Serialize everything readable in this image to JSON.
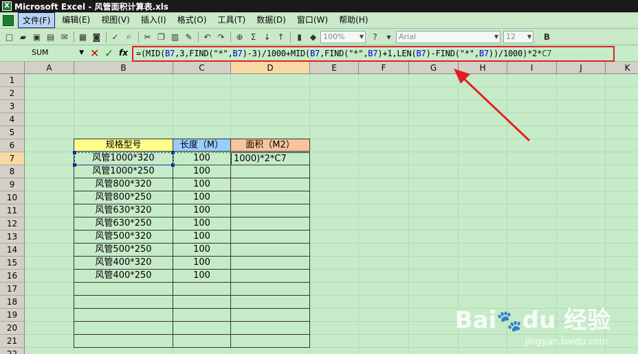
{
  "window": {
    "title": "Microsoft Excel - 风管面积计算表.xls"
  },
  "menu": [
    {
      "label": "文件(F)",
      "active": true
    },
    {
      "label": "编辑(E)"
    },
    {
      "label": "视图(V)"
    },
    {
      "label": "插入(I)"
    },
    {
      "label": "格式(O)"
    },
    {
      "label": "工具(T)"
    },
    {
      "label": "数据(D)"
    },
    {
      "label": "窗口(W)"
    },
    {
      "label": "帮助(H)"
    }
  ],
  "toolbar": {
    "zoom": "100%",
    "font_name": "Arial",
    "font_size": "12",
    "bold_label": "B",
    "sigma_label": "Σ"
  },
  "formula_bar": {
    "name_box": "SUM",
    "fx_label": "fx",
    "formula": "=(MID(B7,3,FIND(\"*\",B7)-3)/1000+MID(B7,FIND(\"*\",B7)+1,LEN(B7)-FIND(\"*\",B7))/1000)*2*C7",
    "formula_parts": [
      "=(MID(",
      "B7",
      ",3,FIND(\"*\",",
      "B7",
      ")-3)/1000+MID(",
      "B7",
      ",FIND(\"*\",",
      "B7",
      ")+1,LEN(",
      "B7",
      ")-FIND(\"*\",",
      "B7",
      "))/1000)*2*",
      "C7"
    ]
  },
  "sheet": {
    "columns": [
      "A",
      "B",
      "C",
      "D",
      "E",
      "F",
      "G",
      "H",
      "I",
      "J",
      "K"
    ],
    "rows": [
      "1",
      "2",
      "3",
      "4",
      "5",
      "6",
      "7",
      "8",
      "9",
      "10",
      "11",
      "12",
      "13",
      "14",
      "15",
      "16",
      "17",
      "18",
      "19",
      "20",
      "21",
      "22"
    ],
    "selected_column": "D",
    "selected_row": "7",
    "table": {
      "headers": [
        "规格型号",
        "长度（M）",
        "面积（M2）"
      ],
      "editing_text": "1000)*2*C7",
      "rows": [
        {
          "spec": "风管1000*320",
          "length": "100"
        },
        {
          "spec": "风管1000*250",
          "length": "100"
        },
        {
          "spec": "风管800*320",
          "length": "100"
        },
        {
          "spec": "风管800*250",
          "length": "100"
        },
        {
          "spec": "风管630*320",
          "length": "100"
        },
        {
          "spec": "风管630*250",
          "length": "100"
        },
        {
          "spec": "风管500*320",
          "length": "100"
        },
        {
          "spec": "风管500*250",
          "length": "100"
        },
        {
          "spec": "风管400*320",
          "length": "100"
        },
        {
          "spec": "风管400*250",
          "length": "100"
        }
      ]
    }
  },
  "watermark": {
    "brand": "Bai du 经验",
    "url": "jingyan.baidu.com"
  },
  "colors": {
    "formula_highlight": "#e02020",
    "sheet_bg": "#c6ebc8",
    "header_b": "#ffff88",
    "header_c": "#99ccff",
    "header_d": "#f9c49b"
  }
}
